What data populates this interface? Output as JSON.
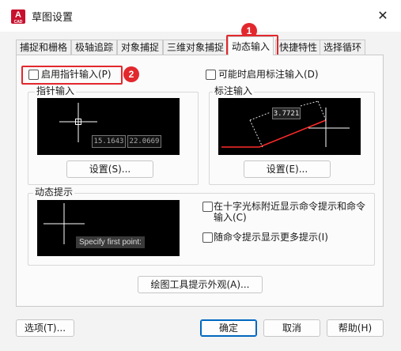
{
  "window": {
    "title": "草图设置",
    "app_icon_letter": "A",
    "app_icon_sub": "CAD"
  },
  "tabs": [
    {
      "label": "捕捉和栅格"
    },
    {
      "label": "极轴追踪"
    },
    {
      "label": "对象捕捉"
    },
    {
      "label": "三维对象捕捉"
    },
    {
      "label": "动态输入"
    },
    {
      "label": "快捷特性"
    },
    {
      "label": "选择循环"
    }
  ],
  "active_tab": "动态输入",
  "dynamic_input": {
    "enable_pointer_input_label": "启用指针输入(P)",
    "enable_dimension_input_label": "可能时启用标注输入(D)",
    "pointer_input_group": "指针输入",
    "pointer_preview_values": [
      "15.1643",
      "22.0669"
    ],
    "pointer_settings_button": "设置(S)...",
    "dimension_input_group": "标注输入",
    "dimension_preview_value": "3.7721",
    "dimension_settings_button": "设置(E)...",
    "dynamic_prompt_group": "动态提示",
    "prompt_preview_text": "Specify first point:",
    "show_prompts_near_crosshair_label_line1": "在十字光标附近显示命令提示和命令",
    "show_prompts_near_crosshair_label_line2": "输入(C)",
    "show_more_prompts_label": "随命令提示显示更多提示(I)",
    "drafting_tooltip_button": "绘图工具提示外观(A)..."
  },
  "annotations": {
    "badge1": "1",
    "badge2": "2",
    "color": "#e2282d"
  },
  "footer": {
    "options_button": "选项(T)...",
    "ok_button": "确定",
    "cancel_button": "取消",
    "help_button": "帮助(H)"
  }
}
